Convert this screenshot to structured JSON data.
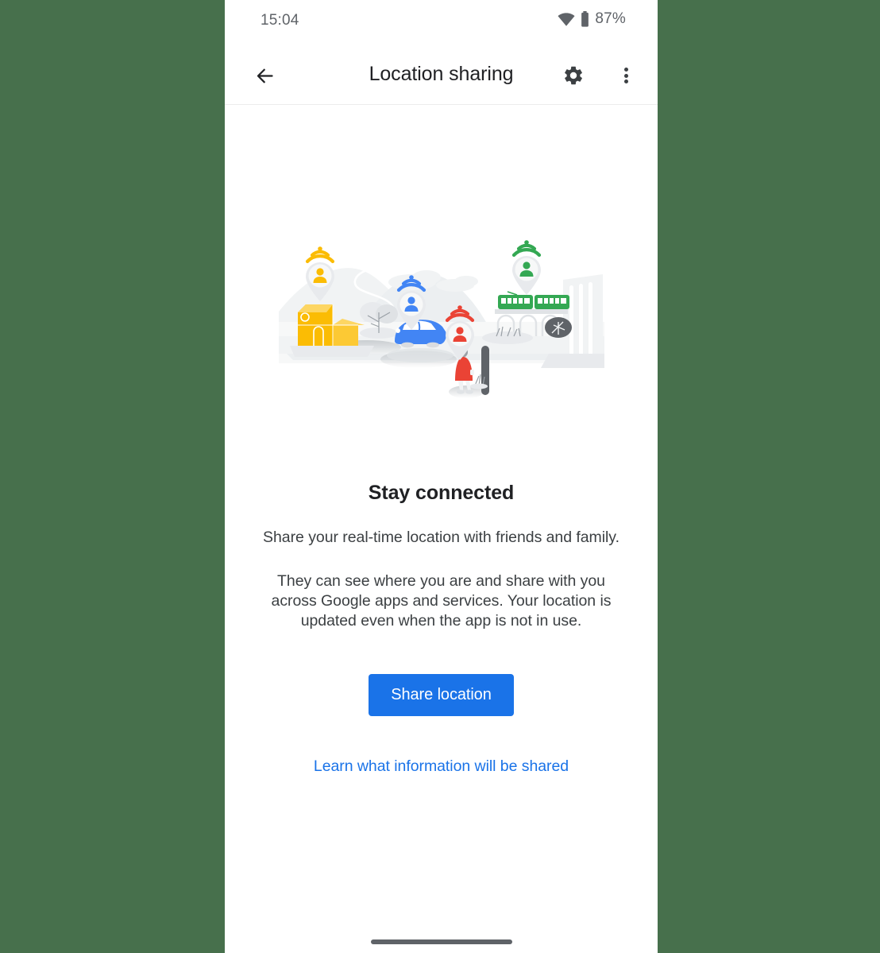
{
  "backdrop": {
    "color": "#47704C"
  },
  "status_bar": {
    "time": "15:04",
    "battery_percent": "87%",
    "wifi_icon": "wifi-icon",
    "battery_icon": "battery-icon"
  },
  "app_bar": {
    "title": "Location sharing",
    "back_icon": "back-arrow-icon",
    "settings_icon": "gear-icon",
    "overflow_icon": "more-vert-icon"
  },
  "illustration": {
    "name": "stay-connected-city-illustration",
    "pins": [
      {
        "label": "yellow-location-pin",
        "color": "#FBBC04"
      },
      {
        "label": "blue-location-pin",
        "color": "#4285F4"
      },
      {
        "label": "red-location-pin",
        "color": "#EA4335"
      },
      {
        "label": "green-location-pin",
        "color": "#34A853"
      }
    ],
    "objects": [
      "yellow-building",
      "blue-car",
      "green-tram",
      "person-in-red-jacket",
      "gray-skyscrapers",
      "gray-trees",
      "gray-hills",
      "gray-clouds",
      "viaduct-arches"
    ]
  },
  "main": {
    "headline": "Stay connected",
    "subhead": "Share your real-time location with friends and family.",
    "body": "They can see where you are and share with you across Google apps and services. Your location is updated even when the app is not in use.",
    "primary_button_label": "Share location",
    "primary_button_color": "#1a73e8",
    "link_label": "Learn what information will be shared",
    "link_color": "#1a73e8"
  },
  "gesture_nav": {
    "handle": "home-gesture-pill"
  }
}
